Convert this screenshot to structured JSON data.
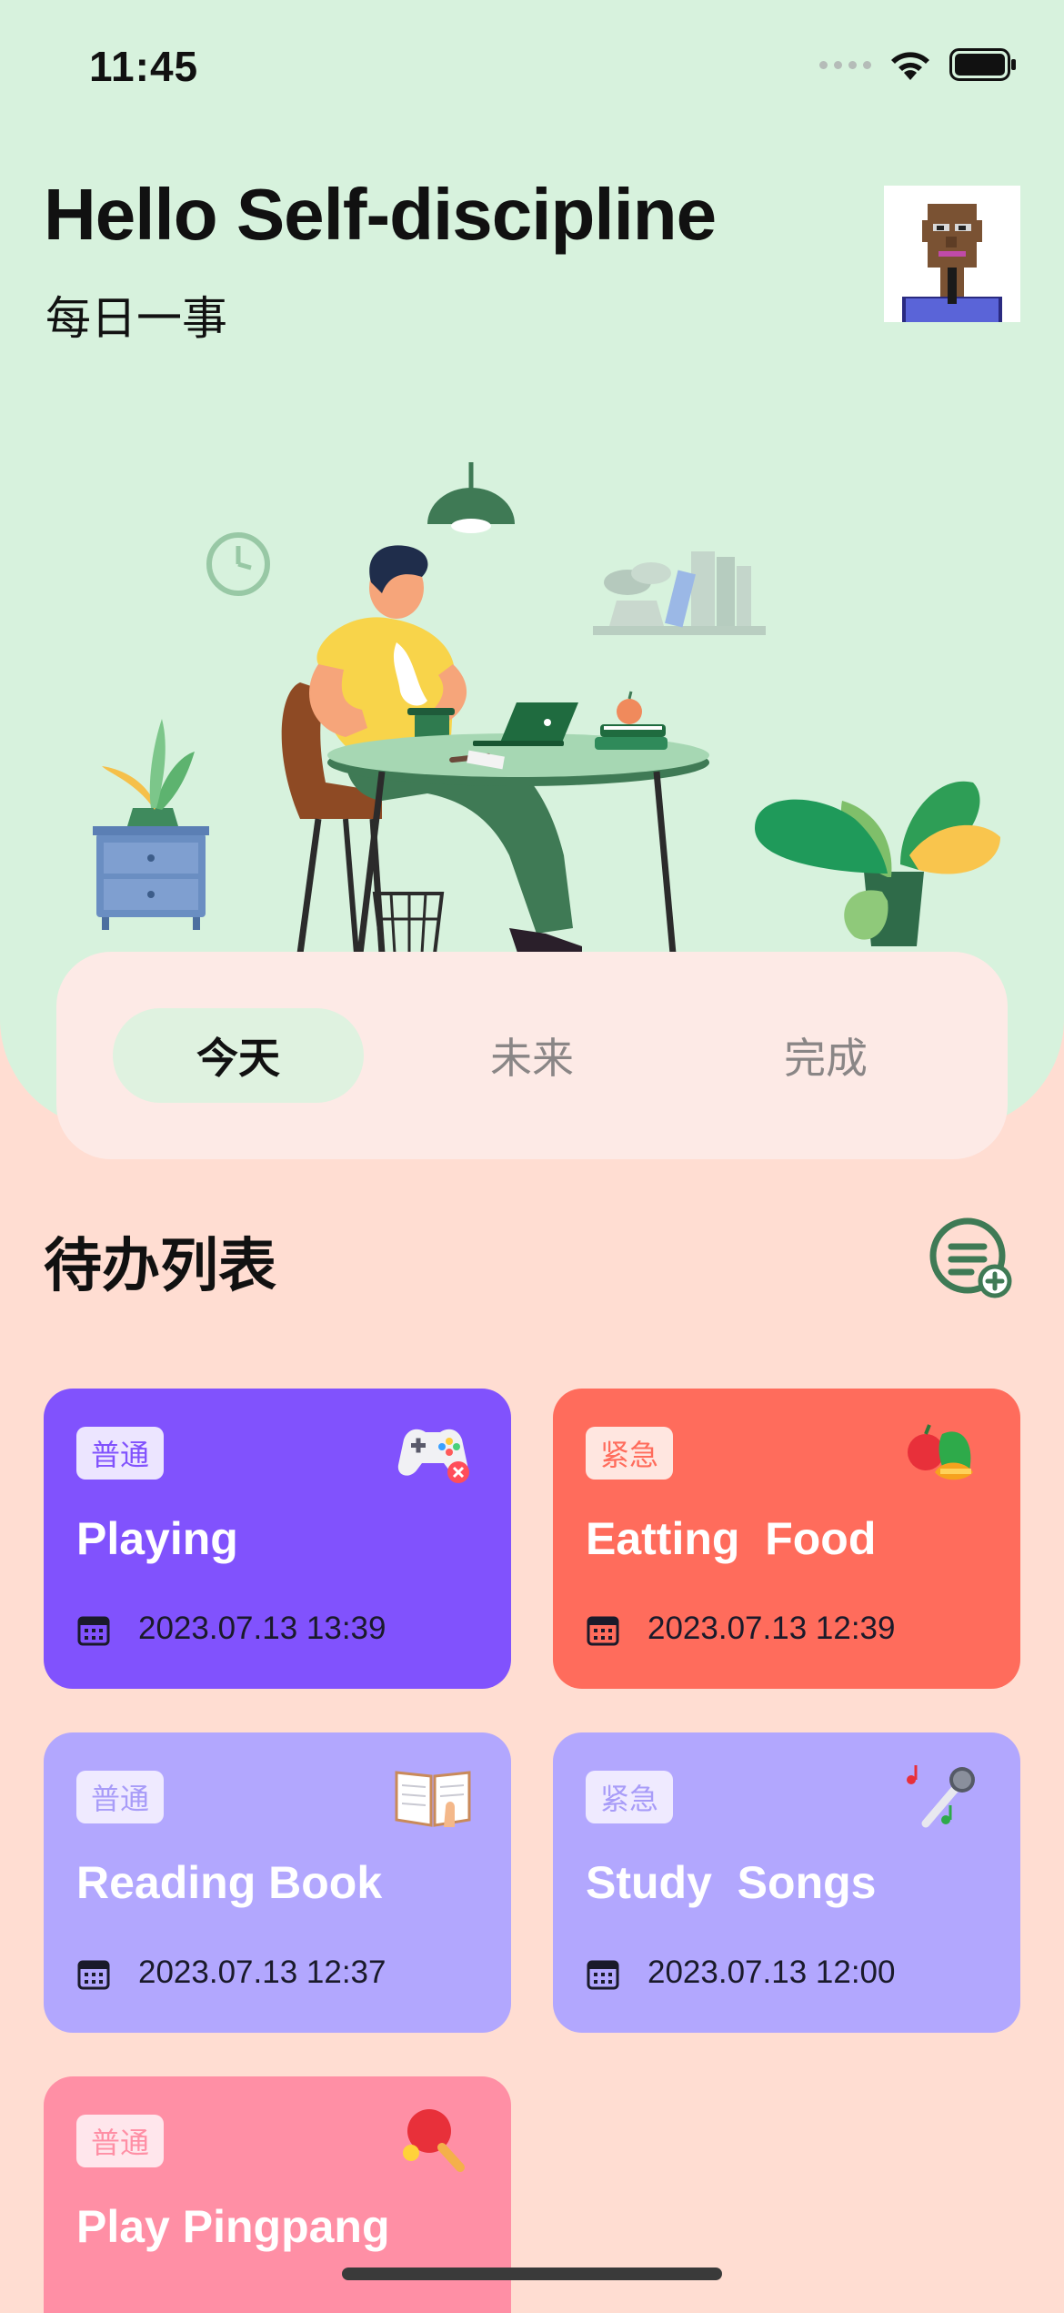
{
  "status_bar": {
    "time": "11:45"
  },
  "header": {
    "title": "Hello Self-discipline",
    "subtitle": "每日一事"
  },
  "tabs": [
    {
      "label": "今天",
      "active": true
    },
    {
      "label": "未来",
      "active": false
    },
    {
      "label": "完成",
      "active": false
    }
  ],
  "section": {
    "title": "待办列表"
  },
  "tasks": [
    {
      "tag": "普通",
      "title": "Playing",
      "date": "2023.07.13 13:39",
      "icon": "gamepad-icon",
      "color": "#8152fd"
    },
    {
      "tag": "紧急",
      "title": "Eatting  Food",
      "date": "2023.07.13 12:39",
      "icon": "food-icon",
      "color": "#ff6c5c"
    },
    {
      "tag": "普通",
      "title": "Reading Book",
      "date": "2023.07.13 12:37",
      "icon": "book-icon",
      "color": "#b2a7fe"
    },
    {
      "tag": "紧急",
      "title": "Study  Songs",
      "date": "2023.07.13 12:00",
      "icon": "microphone-icon",
      "color": "#b2a7fe"
    },
    {
      "tag": "普通",
      "title": "Play Pingpang",
      "date": "",
      "icon": "ping-pong-icon",
      "color": "#ff8fa5"
    }
  ],
  "colors": {
    "hero_background": "#d7f2dd",
    "page_background": "#ffddd2",
    "active_tab": "#dff2e0",
    "accent_green": "#3f7a55"
  }
}
